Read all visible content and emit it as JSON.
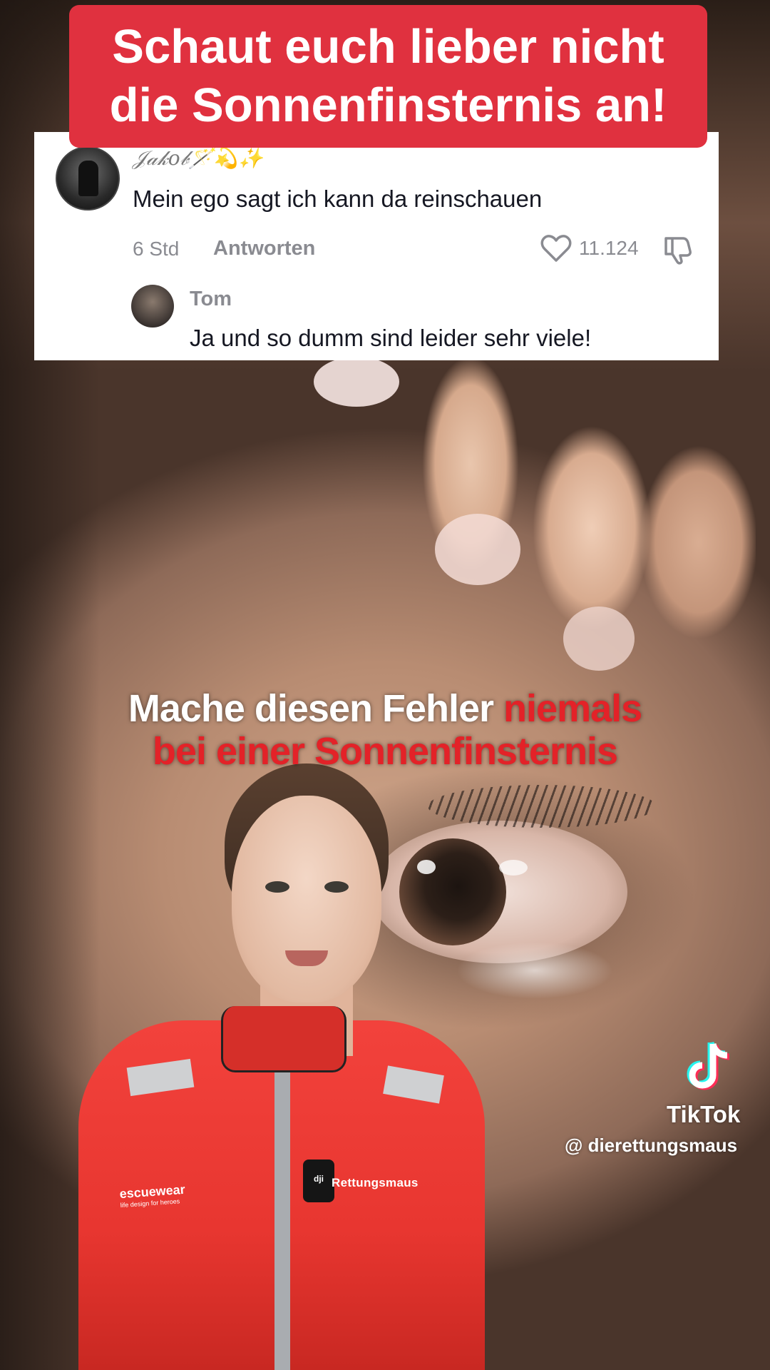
{
  "banner": {
    "line1": "Schaut euch lieber nicht",
    "line2": "die Sonnenfinsternis an!",
    "color": "#e0313f"
  },
  "comment": {
    "username": "𝒥𝒶𝓀𝑜𝒷🪄💫✨",
    "text": "Mein ego sagt ich kann da reinschauen",
    "time": "6 Std",
    "reply_label": "Antworten",
    "likes": "11.124",
    "reply": {
      "username": "Tom",
      "text": "Ja und so dumm sind leider sehr viele!"
    }
  },
  "caption": {
    "line1_white": "Mache diesen Fehler ",
    "line1_red": "niemals",
    "line2_red": "bei einer Sonnenfinsternis",
    "red_color": "#e32228"
  },
  "presenter": {
    "jacket_brand": "escuewear",
    "jacket_brand_sub": "life design for heroes",
    "name_tag": "Rettungsmaus",
    "mic_label": "dji"
  },
  "watermark": {
    "brand": "TikTok",
    "handle": "@ dierettungsmaus"
  },
  "icons": {
    "like": "heart-icon",
    "dislike": "thumbs-down-icon",
    "logo": "tiktok-logo-icon"
  }
}
